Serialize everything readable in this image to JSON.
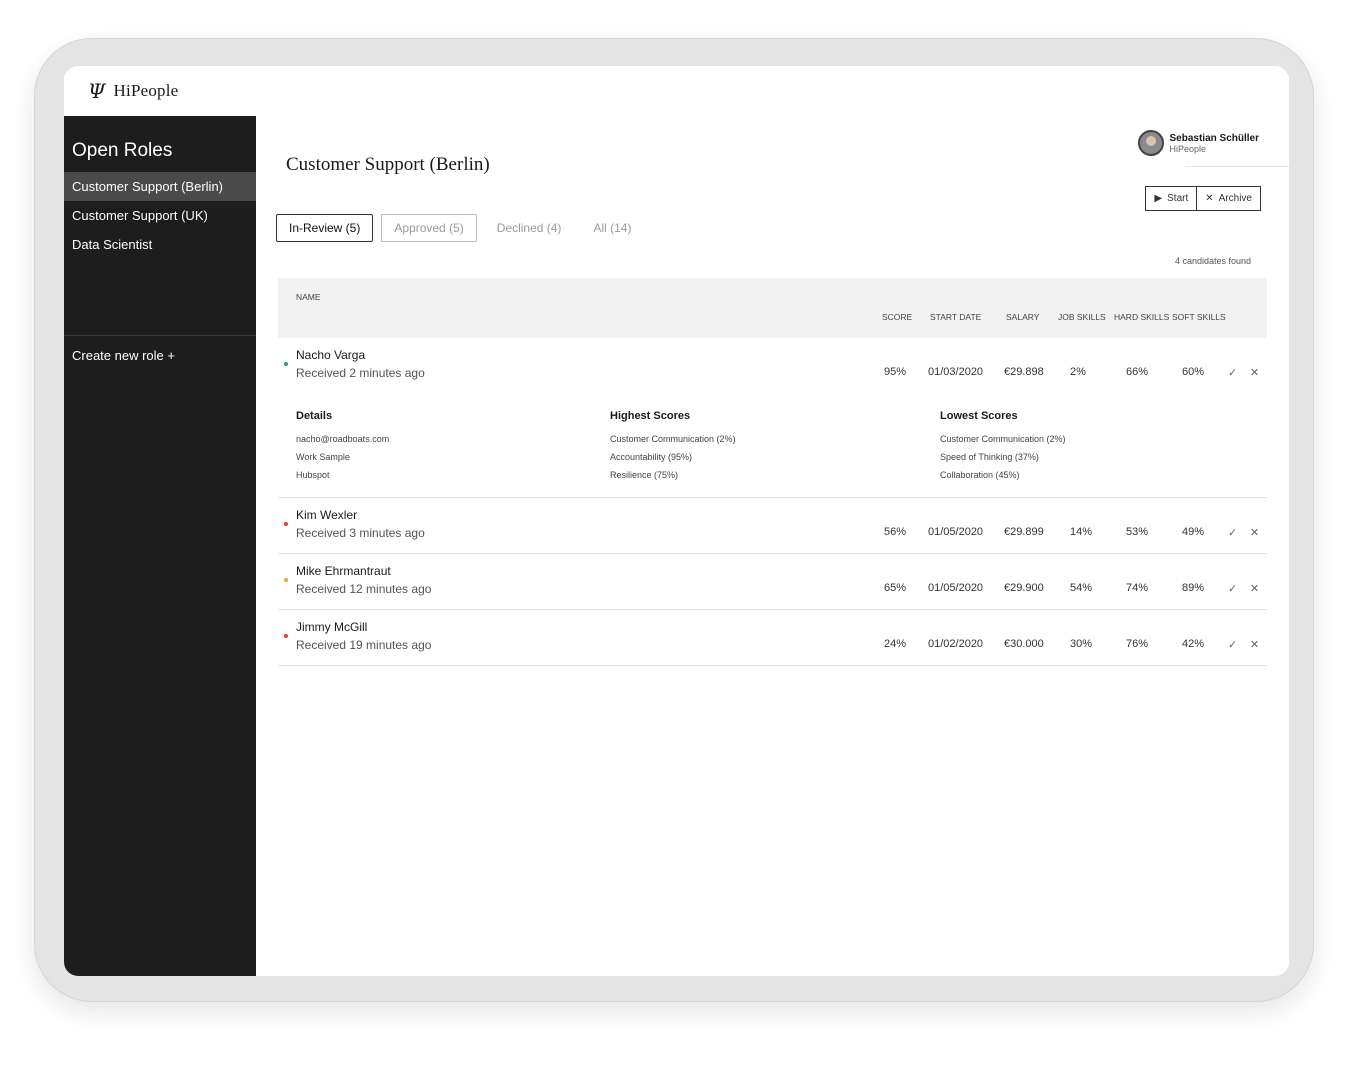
{
  "app": {
    "logo_mark": "Ψ",
    "logo_text": "HiPeople"
  },
  "sidebar": {
    "title": "Open Roles",
    "items": [
      {
        "label": "Customer Support (Berlin)",
        "active": true
      },
      {
        "label": "Customer Support (UK)",
        "active": false
      },
      {
        "label": "Data Scientist",
        "active": false
      }
    ],
    "create_label": "Create new role +"
  },
  "user": {
    "name": "Sebastian Schüller",
    "org": "HiPeople"
  },
  "page": {
    "title": "Customer Support (Berlin)"
  },
  "actions": {
    "start_label": "Start",
    "archive_label": "Archive"
  },
  "tabs": [
    {
      "label": "In-Review (5)",
      "state": "active"
    },
    {
      "label": "Approved (5)",
      "state": "outlined"
    },
    {
      "label": "Declined (4)",
      "state": "plain"
    },
    {
      "label": "All (14)",
      "state": "plain"
    }
  ],
  "found_text": "4  candidates found",
  "table": {
    "headers": {
      "name": "NAME",
      "score": "SCORE",
      "start_date": "START DATE",
      "salary": "SALARY",
      "job_skills": "JOB SKILLS",
      "hard_skills": "HARD SKILLS",
      "soft_skills": "SOFT SKILLS"
    },
    "rows": [
      {
        "name": "Nacho Varga",
        "received": "Received 2 minutes ago",
        "status_color": "#2ea36a",
        "score": "95%",
        "start_date": "01/03/2020",
        "salary": "€29.898",
        "job_skills": "2%",
        "hard_skills": "66%",
        "soft_skills": "60%",
        "details": {
          "details_title": "Details",
          "details_items": [
            "nacho@roadboats.com",
            "Work Sample",
            "Hubspot"
          ],
          "highest_title": "Highest Scores",
          "highest_items": [
            "Customer Communication (2%)",
            "Accountability (95%)",
            "Resilience (75%)"
          ],
          "lowest_title": "Lowest Scores",
          "lowest_items": [
            "Customer Communication (2%)",
            "Speed of Thinking (37%)",
            "Collaboration (45%)"
          ]
        }
      },
      {
        "name": "Kim Wexler",
        "received": "Received 3 minutes ago",
        "status_color": "#d9453a",
        "score": "56%",
        "start_date": "01/05/2020",
        "salary": "€29.899",
        "job_skills": "14%",
        "hard_skills": "53%",
        "soft_skills": "49%"
      },
      {
        "name": "Mike Ehrmantraut",
        "received": "Received 12 minutes ago",
        "status_color": "#e9a23a",
        "score": "65%",
        "start_date": "01/05/2020",
        "salary": "€29.900",
        "job_skills": "54%",
        "hard_skills": "74%",
        "soft_skills": "89%"
      },
      {
        "name": "Jimmy McGill",
        "received": "Received 19 minutes ago",
        "status_color": "#d9453a",
        "score": "24%",
        "start_date": "01/02/2020",
        "salary": "€30.000",
        "job_skills": "30%",
        "hard_skills": "76%",
        "soft_skills": "42%"
      }
    ],
    "approve_icon": "✓",
    "decline_icon": "✕"
  }
}
